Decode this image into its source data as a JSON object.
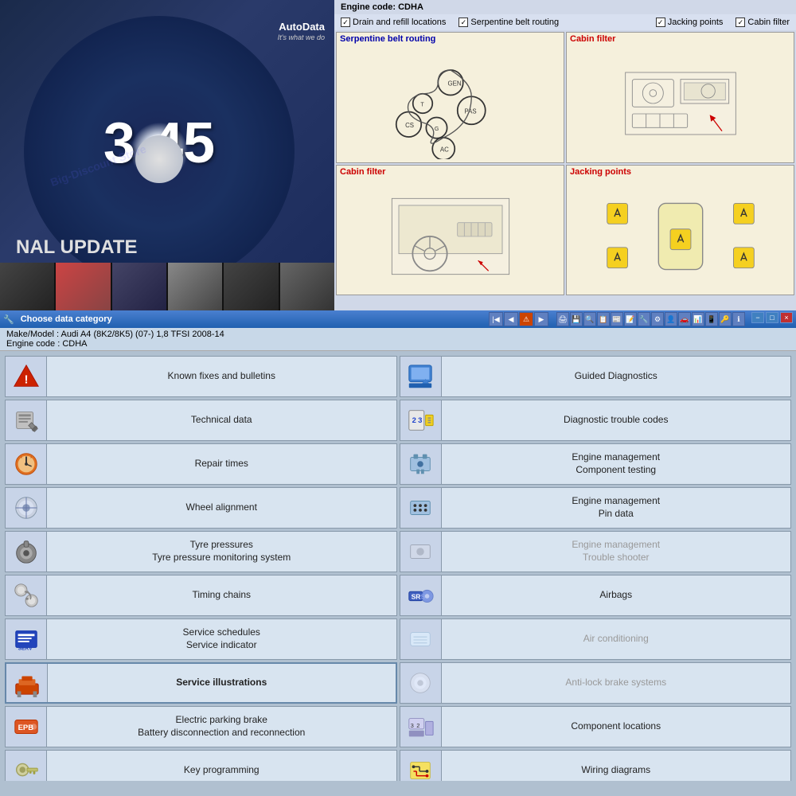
{
  "top": {
    "engine_code_label": "Engine code: CDHA",
    "checkboxes": [
      {
        "label": "Drain and refill locations",
        "checked": true
      },
      {
        "label": "Serpentine belt routing",
        "checked": true
      },
      {
        "label": "Jacking points",
        "checked": true
      },
      {
        "label": "Cabin filter",
        "checked": true
      }
    ],
    "diagram1_title": "Serpentine belt routing",
    "diagram1_color": "blue",
    "diagram2_title": "Cabin filter",
    "diagram2_color": "red",
    "diagram3_title": "Cabin filter",
    "diagram3_color": "red",
    "diagram4_title": "Jacking points",
    "diagram4_color": "red"
  },
  "cd": {
    "version": "3.45",
    "brand": "AutoData",
    "tagline": "It's what we do",
    "bottom_text": "NAL UPDATE",
    "watermark": "Big-Discount Store"
  },
  "window": {
    "title": "Choose data category",
    "close_btn": "×",
    "min_btn": "−",
    "max_btn": "□",
    "make_model": "Make/Model : Audi  A4 (8K2/8K5) (07-) 1,8 TFSI 2008-14",
    "engine_code": "Engine code : CDHA"
  },
  "items": [
    {
      "id": "known-fixes",
      "label": "Known fixes and bulletins",
      "icon": "warning",
      "bold": false,
      "grayed": false
    },
    {
      "id": "guided-diag",
      "label": "Guided Diagnostics",
      "icon": "guided",
      "bold": false,
      "grayed": false
    },
    {
      "id": "tech-data",
      "label": "Technical data",
      "icon": "wrench",
      "bold": false,
      "grayed": false
    },
    {
      "id": "dtc",
      "label": "Diagnostic trouble codes",
      "icon": "dtc",
      "bold": false,
      "grayed": false
    },
    {
      "id": "repair-times",
      "label": "Repair times",
      "icon": "clock",
      "bold": false,
      "grayed": false
    },
    {
      "id": "engine-comp",
      "label": "Engine management\nComponent testing",
      "icon": "engine",
      "bold": false,
      "grayed": false
    },
    {
      "id": "wheel-align",
      "label": "Wheel alignment",
      "icon": "wheel",
      "bold": false,
      "grayed": false
    },
    {
      "id": "engine-pin",
      "label": "Engine management\nPin data",
      "icon": "engine2",
      "bold": false,
      "grayed": false
    },
    {
      "id": "tyre-press",
      "label": "Tyre pressures\nTyre pressure monitoring system",
      "icon": "tyre",
      "bold": false,
      "grayed": false
    },
    {
      "id": "engine-trouble",
      "label": "Engine management\nTrouble shooter",
      "icon": "engine3",
      "bold": false,
      "grayed": true
    },
    {
      "id": "timing",
      "label": "Timing chains",
      "icon": "chain",
      "bold": false,
      "grayed": false
    },
    {
      "id": "airbags",
      "label": "Airbags",
      "icon": "airbag",
      "bold": false,
      "grayed": false
    },
    {
      "id": "service-sched",
      "label": "Service schedules\nService indicator",
      "icon": "service",
      "bold": false,
      "grayed": false
    },
    {
      "id": "air-cond",
      "label": "Air conditioning",
      "icon": "aircon",
      "bold": false,
      "grayed": true
    },
    {
      "id": "service-illus",
      "label": "Service illustrations",
      "icon": "lift",
      "bold": true,
      "grayed": false
    },
    {
      "id": "abs",
      "label": "Anti-lock brake systems",
      "icon": "abs",
      "bold": false,
      "grayed": true
    },
    {
      "id": "epb",
      "label": "Electric parking brake\nBattery disconnection and reconnection",
      "icon": "epb",
      "bold": false,
      "grayed": false
    },
    {
      "id": "comp-loc",
      "label": "Component locations",
      "icon": "comploc",
      "bold": false,
      "grayed": false
    },
    {
      "id": "key-prog",
      "label": "Key programming",
      "icon": "key",
      "bold": false,
      "grayed": false
    },
    {
      "id": "wiring",
      "label": "Wiring diagrams",
      "icon": "wiring",
      "bold": false,
      "grayed": false
    }
  ]
}
